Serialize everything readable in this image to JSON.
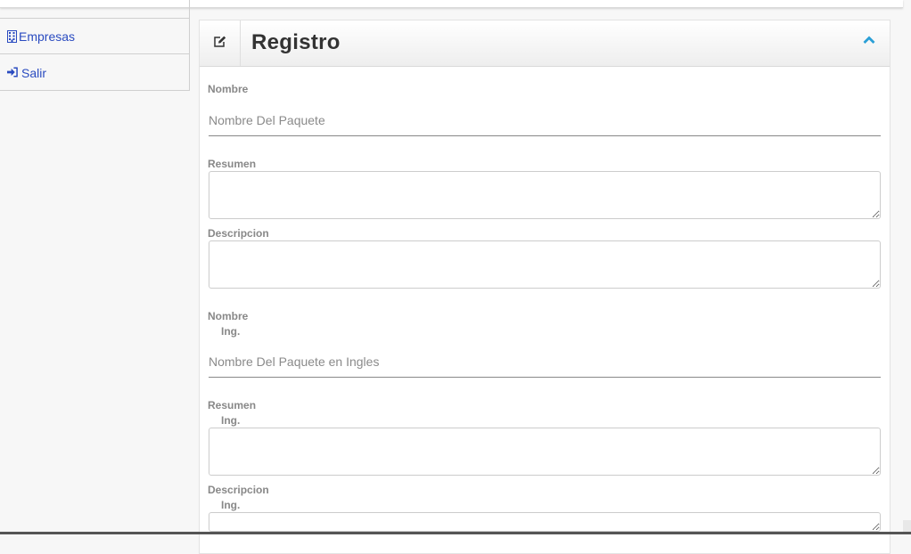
{
  "sidebar": {
    "items": [
      {
        "label": "Empresas",
        "icon": "building-icon"
      },
      {
        "label": "Salir",
        "icon": "sign-in-icon"
      }
    ]
  },
  "panel": {
    "title": "Registro",
    "header_icon": "edit-icon",
    "collapse_icon": "chevron-up-icon"
  },
  "form": {
    "nombre": {
      "label": "Nombre",
      "placeholder": "Nombre Del Paquete",
      "value": ""
    },
    "resumen": {
      "label": "Resumen",
      "value": ""
    },
    "descripcion": {
      "label": "Descripcion",
      "value": ""
    },
    "nombre_ing": {
      "label": "Nombre",
      "sub": "Ing.",
      "placeholder": "Nombre Del Paquete en Ingles",
      "value": ""
    },
    "resumen_ing": {
      "label": "Resumen",
      "sub": "Ing.",
      "value": ""
    },
    "descripcion_ing": {
      "label": "Descripcion",
      "sub": "Ing.",
      "value": ""
    }
  },
  "colors": {
    "link": "#2a4bc0",
    "accent": "#2a9fd6",
    "label": "#888888"
  }
}
